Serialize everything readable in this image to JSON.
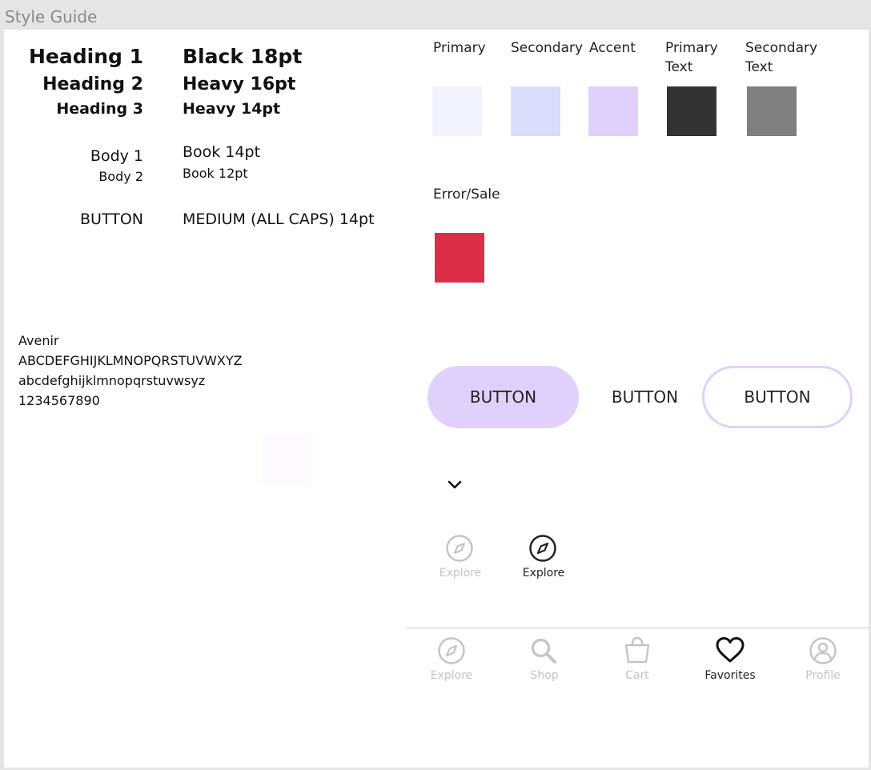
{
  "frame_title": "Style Guide",
  "typography": {
    "heading1": {
      "label": "Heading 1",
      "spec": "Black 18pt"
    },
    "heading2": {
      "label": "Heading 2",
      "spec": "Heavy 16pt"
    },
    "heading3": {
      "label": "Heading 3",
      "spec": "Heavy 14pt"
    },
    "body1": {
      "label": "Body 1",
      "spec": "Book 14pt"
    },
    "body2": {
      "label": "Body 2",
      "spec": "Book 12pt"
    },
    "button": {
      "label": "BUTTON",
      "spec": "MEDIUM (ALL CAPS) 14pt"
    }
  },
  "font_sample": {
    "name": "Avenir",
    "uppercase": "ABCDEFGHIJKLMNOPQRSTUVWXYZ",
    "lowercase": "abcdefghijklmnopqrstuvwsyz",
    "digits": "1234567890"
  },
  "colors": {
    "primary": {
      "label": "Primary",
      "hex": "#f1f4ff"
    },
    "secondary": {
      "label": "Secondary",
      "hex": "#dadcfb"
    },
    "accent": {
      "label": "Accent",
      "hex": "#e1d0fc"
    },
    "primary_text": {
      "label_line1": "Primary",
      "label_line2": "Text",
      "hex": "#333333"
    },
    "secondary_text": {
      "label_line1": "Secondary",
      "label_line2": "Text",
      "hex": "#808080"
    },
    "error_sale": {
      "label": "Error/Sale",
      "hex": "#dd2e49"
    },
    "faint_swatch": {
      "hex": "#fdf9ff"
    }
  },
  "buttons": {
    "filled_label": "BUTTON",
    "text_label": "BUTTON",
    "outline_label": "BUTTON"
  },
  "icons": {
    "chevron": "chevron-down-icon",
    "explore_inactive_label": "Explore",
    "explore_active_label": "Explore"
  },
  "bottom_nav": {
    "items": [
      {
        "label": "Explore",
        "icon": "compass-icon",
        "active": false
      },
      {
        "label": "Shop",
        "icon": "search-icon",
        "active": false
      },
      {
        "label": "Cart",
        "icon": "bag-icon",
        "active": false
      },
      {
        "label": "Favorites",
        "icon": "heart-icon",
        "active": true
      },
      {
        "label": "Profile",
        "icon": "user-icon",
        "active": false
      }
    ]
  }
}
